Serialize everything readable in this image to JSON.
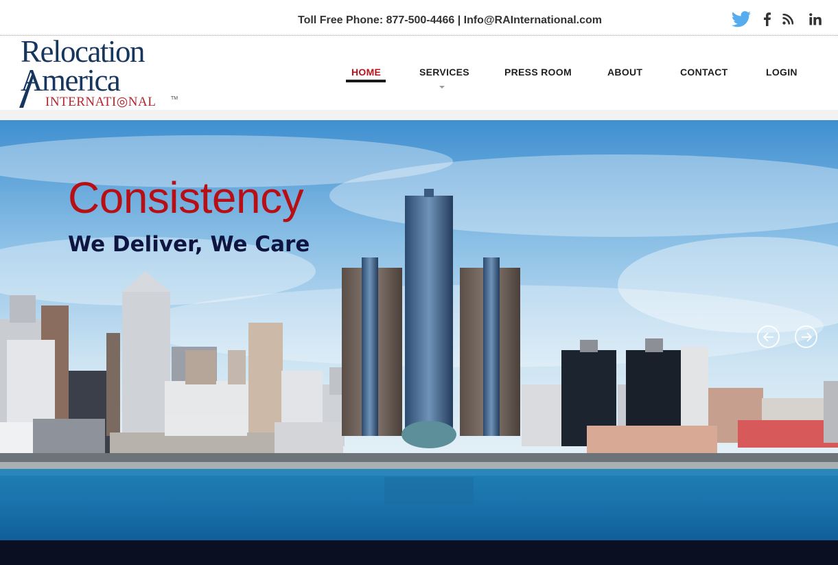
{
  "topbar": {
    "phone_label": "Toll Free Phone: 877-500-4466",
    "separator": " | ",
    "email": "Info@RAInternational.com",
    "social": [
      {
        "name": "twitter",
        "icon": "twitter-bird-icon"
      },
      {
        "name": "facebook",
        "icon": "facebook-icon"
      },
      {
        "name": "rss",
        "icon": "rss-feed-icon"
      },
      {
        "name": "linkedin",
        "icon": "linkedin-icon"
      }
    ]
  },
  "logo": {
    "line1": "Relocation",
    "line2": "America",
    "line3": "INTERNATI◎NAL",
    "tm": "TM"
  },
  "nav": {
    "items": [
      {
        "label": "HOME",
        "active": true
      },
      {
        "label": "SERVICES",
        "has_submenu": true
      },
      {
        "label": "PRESS ROOM"
      },
      {
        "label": "ABOUT"
      },
      {
        "label": "CONTACT"
      },
      {
        "label": "LOGIN"
      }
    ]
  },
  "hero": {
    "title": "Consistency",
    "subtitle": "We Deliver, We Care",
    "prev_icon": "arrow-left-icon",
    "next_icon": "arrow-right-icon"
  },
  "colors": {
    "accent_red": "#b70f16",
    "navy": "#17365d",
    "twitter_blue": "#55acee",
    "footer": "#0a0f22"
  }
}
